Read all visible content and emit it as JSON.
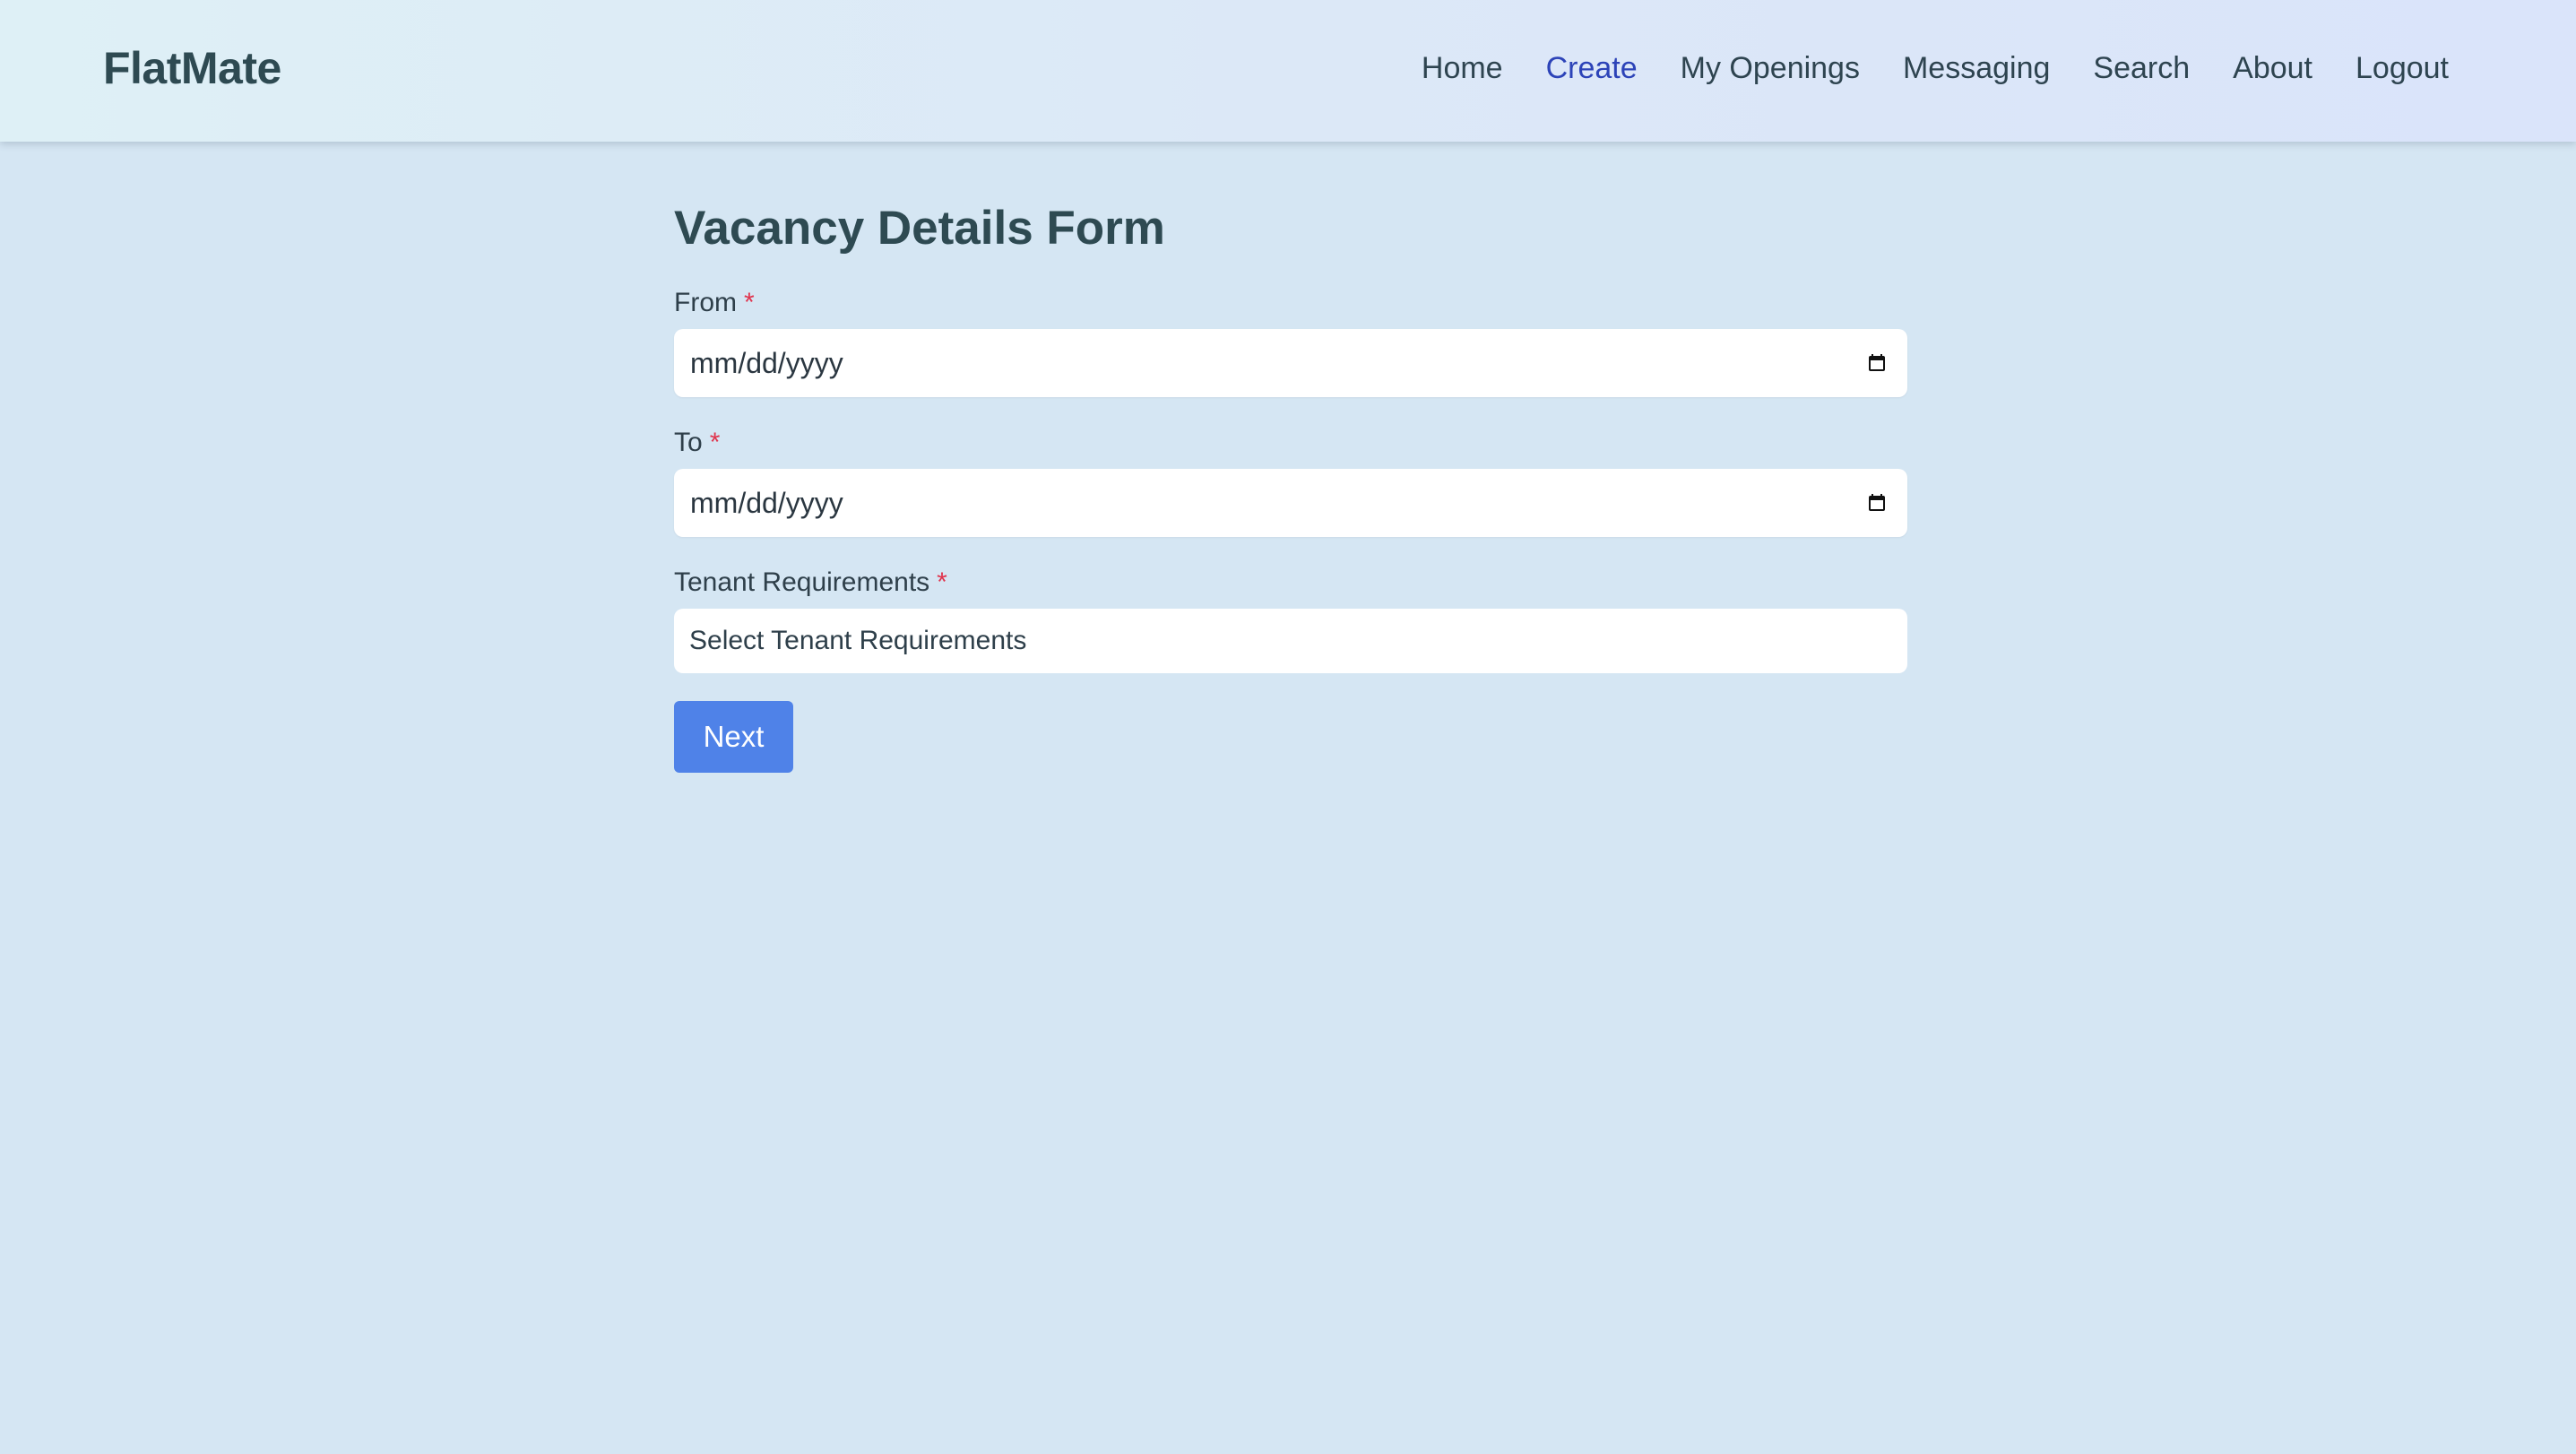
{
  "navbar": {
    "brand": "FlatMate",
    "links": [
      {
        "label": "Home",
        "active": false
      },
      {
        "label": "Create",
        "active": true
      },
      {
        "label": "My Openings",
        "active": false
      },
      {
        "label": "Messaging",
        "active": false
      },
      {
        "label": "Search",
        "active": false
      },
      {
        "label": "About",
        "active": false
      },
      {
        "label": "Logout",
        "active": false
      }
    ]
  },
  "form": {
    "title": "Vacancy Details Form",
    "from": {
      "label": "From",
      "required_mark": "*",
      "placeholder": "mm/dd/yyyy",
      "icon": "calendar-icon"
    },
    "to": {
      "label": "To",
      "required_mark": "*",
      "placeholder": "mm/dd/yyyy",
      "icon": "calendar-icon"
    },
    "tenant_requirements": {
      "label": "Tenant Requirements",
      "required_mark": "*",
      "placeholder": "Select Tenant Requirements"
    },
    "next_label": "Next"
  },
  "colors": {
    "background": "#d5e6f3",
    "accent": "#4f82e8",
    "active_link": "#2c43b8",
    "required": "#e0344d"
  }
}
